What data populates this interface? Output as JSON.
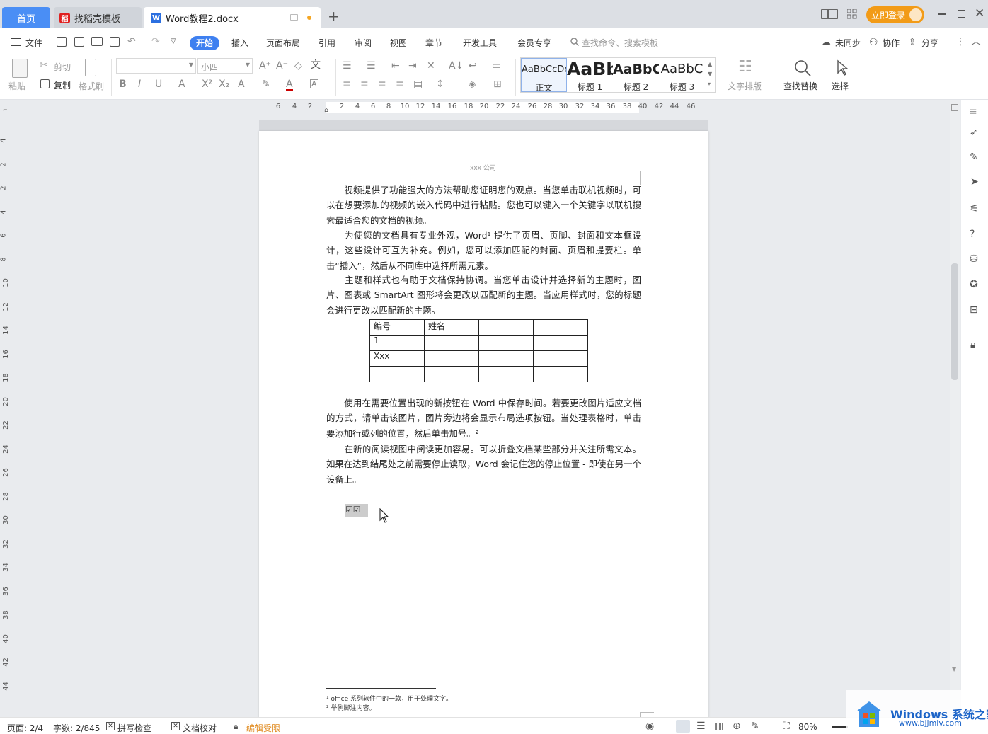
{
  "tabs": {
    "home": "首页",
    "templates": "找稻壳模板",
    "document": "Word教程2.docx"
  },
  "login_label": "立即登录",
  "menu": {
    "file": "文件",
    "items": [
      "开始",
      "插入",
      "页面布局",
      "引用",
      "审阅",
      "视图",
      "章节",
      "开发工具",
      "会员专享"
    ],
    "search_placeholder": "查找命令、搜索模板",
    "sync": "未同步",
    "collab": "协作",
    "share": "分享"
  },
  "ribbon": {
    "paste": "粘贴",
    "cut": "剪切",
    "copy": "复制",
    "format_painter": "格式刷",
    "font_size": "小四",
    "styles": [
      {
        "preview": "AaBbCcDc",
        "name": "正文"
      },
      {
        "preview": "AaBb",
        "name": "标题 1"
      },
      {
        "preview": "AaBbC",
        "name": "标题 2"
      },
      {
        "preview": "AaBbC",
        "name": "标题 3"
      }
    ],
    "text_layout": "文字排版",
    "find_replace": "查找替换",
    "select": "选择"
  },
  "ruler_numbers": [
    "6",
    "4",
    "2",
    "2",
    "4",
    "6",
    "8",
    "10",
    "12",
    "14",
    "16",
    "18",
    "20",
    "22",
    "24",
    "26",
    "28",
    "30",
    "32",
    "34",
    "36",
    "38",
    "40",
    "42",
    "44",
    "46"
  ],
  "vruler_numbers": [
    "4",
    "2",
    "2",
    "4",
    "6",
    "8",
    "10",
    "12",
    "14",
    "16",
    "18",
    "20",
    "22",
    "24",
    "26",
    "28",
    "30",
    "32",
    "34",
    "36",
    "38",
    "40",
    "42",
    "44"
  ],
  "document": {
    "header": "xxx 公司",
    "paragraphs": [
      "　　视频提供了功能强大的方法帮助您证明您的观点。当您单击联机视频时，可以在想要添加的视频的嵌入代码中进行粘贴。您也可以键入一个关键字以联机搜索最适合您的文档的视频。",
      "　　为使您的文档具有专业外观，Word¹ 提供了页眉、页脚、封面和文本框设计，这些设计可互为补充。例如，您可以添加匹配的封面、页眉和提要栏。单击“插入”，然后从不同库中选择所需元素。",
      "　　主题和样式也有助于文档保持协调。当您单击设计并选择新的主题时，图片、图表或 SmartArt 图形将会更改以匹配新的主题。当应用样式时，您的标题会进行更改以匹配新的主题。"
    ],
    "table": [
      [
        "编号",
        "姓名",
        "",
        ""
      ],
      [
        "1",
        "",
        "",
        ""
      ],
      [
        "Xxx",
        "",
        "",
        ""
      ],
      [
        "",
        "",
        "",
        ""
      ]
    ],
    "paragraphs2": [
      "　　使用在需要位置出现的新按钮在 Word 中保存时间。若要更改图片适应文档的方式，请单击该图片，图片旁边将会显示布局选项按钮。当处理表格时，单击要添加行或列的位置，然后单击加号。²",
      "　　在新的阅读视图中阅读更加容易。可以折叠文档某些部分并关注所需文本。如果在达到结尾处之前需要停止读取，Word 会记住您的停止位置 - 即使在另一个设备上。"
    ],
    "checkboxes": "☑☑",
    "footnotes": [
      "¹  office 系列软件中的一款，用于处理文字。",
      "²  举例脚注内容。"
    ]
  },
  "status": {
    "page": "页面: 2/4",
    "words": "字数: 2/845",
    "spell": "拼写检查",
    "proof": "文档校对",
    "restrict": "编辑受限",
    "zoom": "80%"
  },
  "watermark": {
    "brand": "Windows 系统之家",
    "url": "www.bjjmlv.com"
  },
  "colors": {
    "accent": "#3e80f0",
    "login": "#f29b17",
    "restrict": "#e08a1e"
  }
}
